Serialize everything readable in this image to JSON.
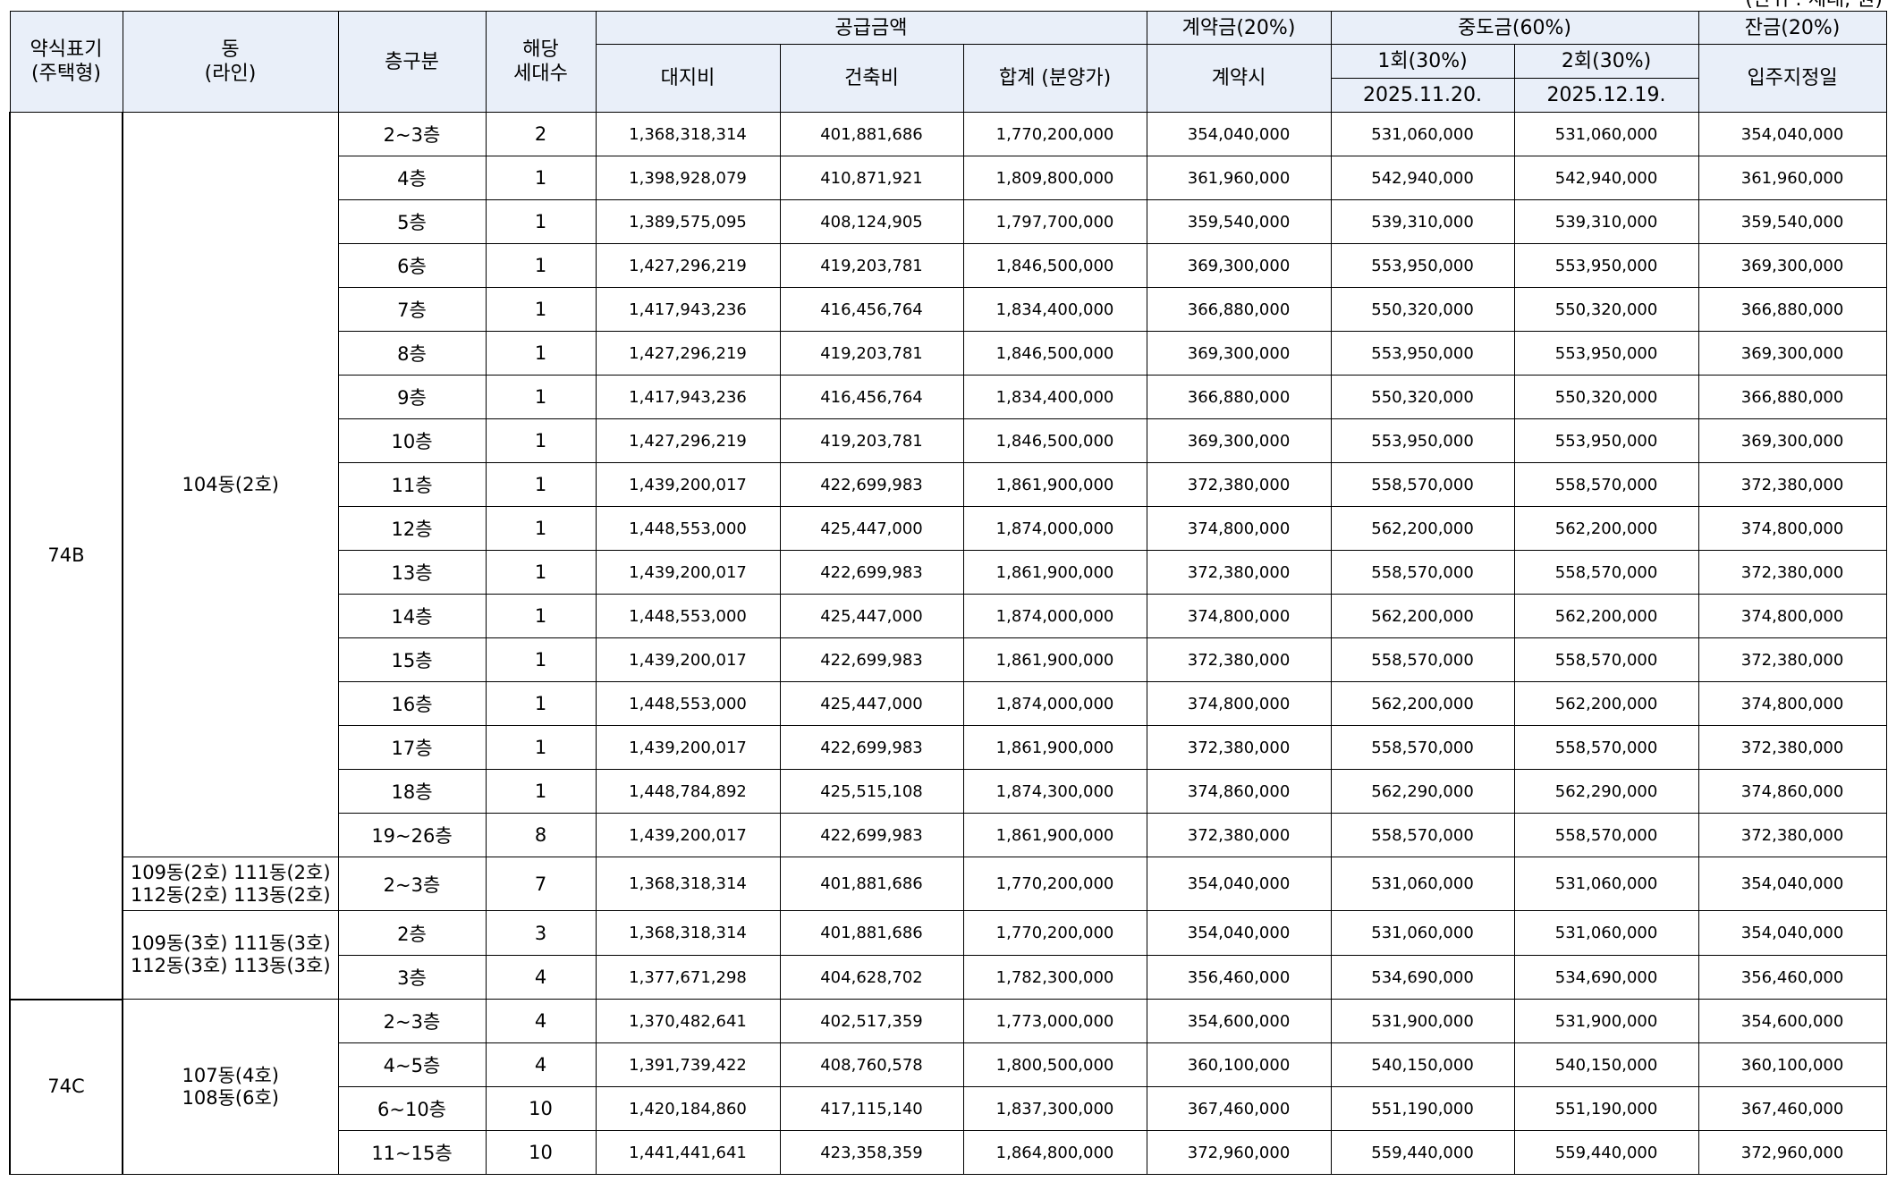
{
  "unit_note": "(단위 : 세대, 원)",
  "headers": {
    "type": "약식표기\n(주택형)",
    "dong": "동\n(라인)",
    "floor": "층구분",
    "households": "해당\n세대수",
    "supply": "공급금액",
    "land": "대지비",
    "building": "건축비",
    "total": "합계 (분양가)",
    "deposit": "계약금(20%)",
    "deposit_sub": "계약시",
    "interim": "중도금(60%)",
    "interim1": "1회(30%)",
    "interim1_date": "2025.11.20.",
    "interim2": "2회(30%)",
    "interim2_date": "2025.12.19.",
    "balance": "잔금(20%)",
    "balance_sub": "입주지정일"
  },
  "groups": [
    {
      "type": "74B",
      "dong": "104동(2호)"
    },
    {
      "dong": "109동(2호)  111동(2호)\n112동(2호)  113동(2호)"
    },
    {
      "dong": "109동(3호)  111동(3호)\n112동(3호)  113동(3호)"
    },
    {
      "type": "74C",
      "dong": "107동(4호)\n108동(6호)"
    }
  ],
  "rows": [
    {
      "floor": "2~3층",
      "count": "2",
      "land": "1,368,318,314",
      "building": "401,881,686",
      "total": "1,770,200,000",
      "deposit": "354,040,000",
      "interim1": "531,060,000",
      "interim2": "531,060,000",
      "balance": "354,040,000"
    },
    {
      "floor": "4층",
      "count": "1",
      "land": "1,398,928,079",
      "building": "410,871,921",
      "total": "1,809,800,000",
      "deposit": "361,960,000",
      "interim1": "542,940,000",
      "interim2": "542,940,000",
      "balance": "361,960,000"
    },
    {
      "floor": "5층",
      "count": "1",
      "land": "1,389,575,095",
      "building": "408,124,905",
      "total": "1,797,700,000",
      "deposit": "359,540,000",
      "interim1": "539,310,000",
      "interim2": "539,310,000",
      "balance": "359,540,000"
    },
    {
      "floor": "6층",
      "count": "1",
      "land": "1,427,296,219",
      "building": "419,203,781",
      "total": "1,846,500,000",
      "deposit": "369,300,000",
      "interim1": "553,950,000",
      "interim2": "553,950,000",
      "balance": "369,300,000"
    },
    {
      "floor": "7층",
      "count": "1",
      "land": "1,417,943,236",
      "building": "416,456,764",
      "total": "1,834,400,000",
      "deposit": "366,880,000",
      "interim1": "550,320,000",
      "interim2": "550,320,000",
      "balance": "366,880,000"
    },
    {
      "floor": "8층",
      "count": "1",
      "land": "1,427,296,219",
      "building": "419,203,781",
      "total": "1,846,500,000",
      "deposit": "369,300,000",
      "interim1": "553,950,000",
      "interim2": "553,950,000",
      "balance": "369,300,000"
    },
    {
      "floor": "9층",
      "count": "1",
      "land": "1,417,943,236",
      "building": "416,456,764",
      "total": "1,834,400,000",
      "deposit": "366,880,000",
      "interim1": "550,320,000",
      "interim2": "550,320,000",
      "balance": "366,880,000"
    },
    {
      "floor": "10층",
      "count": "1",
      "land": "1,427,296,219",
      "building": "419,203,781",
      "total": "1,846,500,000",
      "deposit": "369,300,000",
      "interim1": "553,950,000",
      "interim2": "553,950,000",
      "balance": "369,300,000"
    },
    {
      "floor": "11층",
      "count": "1",
      "land": "1,439,200,017",
      "building": "422,699,983",
      "total": "1,861,900,000",
      "deposit": "372,380,000",
      "interim1": "558,570,000",
      "interim2": "558,570,000",
      "balance": "372,380,000"
    },
    {
      "floor": "12층",
      "count": "1",
      "land": "1,448,553,000",
      "building": "425,447,000",
      "total": "1,874,000,000",
      "deposit": "374,800,000",
      "interim1": "562,200,000",
      "interim2": "562,200,000",
      "balance": "374,800,000"
    },
    {
      "floor": "13층",
      "count": "1",
      "land": "1,439,200,017",
      "building": "422,699,983",
      "total": "1,861,900,000",
      "deposit": "372,380,000",
      "interim1": "558,570,000",
      "interim2": "558,570,000",
      "balance": "372,380,000"
    },
    {
      "floor": "14층",
      "count": "1",
      "land": "1,448,553,000",
      "building": "425,447,000",
      "total": "1,874,000,000",
      "deposit": "374,800,000",
      "interim1": "562,200,000",
      "interim2": "562,200,000",
      "balance": "374,800,000"
    },
    {
      "floor": "15층",
      "count": "1",
      "land": "1,439,200,017",
      "building": "422,699,983",
      "total": "1,861,900,000",
      "deposit": "372,380,000",
      "interim1": "558,570,000",
      "interim2": "558,570,000",
      "balance": "372,380,000"
    },
    {
      "floor": "16층",
      "count": "1",
      "land": "1,448,553,000",
      "building": "425,447,000",
      "total": "1,874,000,000",
      "deposit": "374,800,000",
      "interim1": "562,200,000",
      "interim2": "562,200,000",
      "balance": "374,800,000"
    },
    {
      "floor": "17층",
      "count": "1",
      "land": "1,439,200,017",
      "building": "422,699,983",
      "total": "1,861,900,000",
      "deposit": "372,380,000",
      "interim1": "558,570,000",
      "interim2": "558,570,000",
      "balance": "372,380,000"
    },
    {
      "floor": "18층",
      "count": "1",
      "land": "1,448,784,892",
      "building": "425,515,108",
      "total": "1,874,300,000",
      "deposit": "374,860,000",
      "interim1": "562,290,000",
      "interim2": "562,290,000",
      "balance": "374,860,000"
    },
    {
      "floor": "19~26층",
      "count": "8",
      "land": "1,439,200,017",
      "building": "422,699,983",
      "total": "1,861,900,000",
      "deposit": "372,380,000",
      "interim1": "558,570,000",
      "interim2": "558,570,000",
      "balance": "372,380,000"
    },
    {
      "floor": "2~3층",
      "count": "7",
      "land": "1,368,318,314",
      "building": "401,881,686",
      "total": "1,770,200,000",
      "deposit": "354,040,000",
      "interim1": "531,060,000",
      "interim2": "531,060,000",
      "balance": "354,040,000"
    },
    {
      "floor": "2층",
      "count": "3",
      "land": "1,368,318,314",
      "building": "401,881,686",
      "total": "1,770,200,000",
      "deposit": "354,040,000",
      "interim1": "531,060,000",
      "interim2": "531,060,000",
      "balance": "354,040,000"
    },
    {
      "floor": "3층",
      "count": "4",
      "land": "1,377,671,298",
      "building": "404,628,702",
      "total": "1,782,300,000",
      "deposit": "356,460,000",
      "interim1": "534,690,000",
      "interim2": "534,690,000",
      "balance": "356,460,000"
    },
    {
      "floor": "2~3층",
      "count": "4",
      "land": "1,370,482,641",
      "building": "402,517,359",
      "total": "1,773,000,000",
      "deposit": "354,600,000",
      "interim1": "531,900,000",
      "interim2": "531,900,000",
      "balance": "354,600,000"
    },
    {
      "floor": "4~5층",
      "count": "4",
      "land": "1,391,739,422",
      "building": "408,760,578",
      "total": "1,800,500,000",
      "deposit": "360,100,000",
      "interim1": "540,150,000",
      "interim2": "540,150,000",
      "balance": "360,100,000"
    },
    {
      "floor": "6~10층",
      "count": "10",
      "land": "1,420,184,860",
      "building": "417,115,140",
      "total": "1,837,300,000",
      "deposit": "367,460,000",
      "interim1": "551,190,000",
      "interim2": "551,190,000",
      "balance": "367,460,000"
    },
    {
      "floor": "11~15층",
      "count": "10",
      "land": "1,441,441,641",
      "building": "423,358,359",
      "total": "1,864,800,000",
      "deposit": "372,960,000",
      "interim1": "559,440,000",
      "interim2": "559,440,000",
      "balance": "372,960,000"
    }
  ]
}
